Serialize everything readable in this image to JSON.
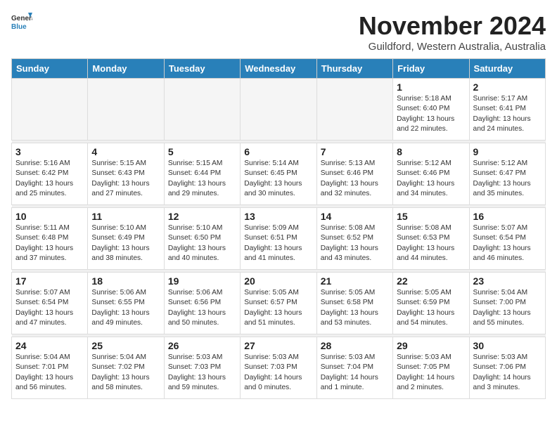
{
  "logo": {
    "general": "General",
    "blue": "Blue"
  },
  "title": "November 2024",
  "location": "Guildford, Western Australia, Australia",
  "weekdays": [
    "Sunday",
    "Monday",
    "Tuesday",
    "Wednesday",
    "Thursday",
    "Friday",
    "Saturday"
  ],
  "weeks": [
    [
      {
        "day": "",
        "detail": ""
      },
      {
        "day": "",
        "detail": ""
      },
      {
        "day": "",
        "detail": ""
      },
      {
        "day": "",
        "detail": ""
      },
      {
        "day": "",
        "detail": ""
      },
      {
        "day": "1",
        "detail": "Sunrise: 5:18 AM\nSunset: 6:40 PM\nDaylight: 13 hours\nand 22 minutes."
      },
      {
        "day": "2",
        "detail": "Sunrise: 5:17 AM\nSunset: 6:41 PM\nDaylight: 13 hours\nand 24 minutes."
      }
    ],
    [
      {
        "day": "3",
        "detail": "Sunrise: 5:16 AM\nSunset: 6:42 PM\nDaylight: 13 hours\nand 25 minutes."
      },
      {
        "day": "4",
        "detail": "Sunrise: 5:15 AM\nSunset: 6:43 PM\nDaylight: 13 hours\nand 27 minutes."
      },
      {
        "day": "5",
        "detail": "Sunrise: 5:15 AM\nSunset: 6:44 PM\nDaylight: 13 hours\nand 29 minutes."
      },
      {
        "day": "6",
        "detail": "Sunrise: 5:14 AM\nSunset: 6:45 PM\nDaylight: 13 hours\nand 30 minutes."
      },
      {
        "day": "7",
        "detail": "Sunrise: 5:13 AM\nSunset: 6:46 PM\nDaylight: 13 hours\nand 32 minutes."
      },
      {
        "day": "8",
        "detail": "Sunrise: 5:12 AM\nSunset: 6:46 PM\nDaylight: 13 hours\nand 34 minutes."
      },
      {
        "day": "9",
        "detail": "Sunrise: 5:12 AM\nSunset: 6:47 PM\nDaylight: 13 hours\nand 35 minutes."
      }
    ],
    [
      {
        "day": "10",
        "detail": "Sunrise: 5:11 AM\nSunset: 6:48 PM\nDaylight: 13 hours\nand 37 minutes."
      },
      {
        "day": "11",
        "detail": "Sunrise: 5:10 AM\nSunset: 6:49 PM\nDaylight: 13 hours\nand 38 minutes."
      },
      {
        "day": "12",
        "detail": "Sunrise: 5:10 AM\nSunset: 6:50 PM\nDaylight: 13 hours\nand 40 minutes."
      },
      {
        "day": "13",
        "detail": "Sunrise: 5:09 AM\nSunset: 6:51 PM\nDaylight: 13 hours\nand 41 minutes."
      },
      {
        "day": "14",
        "detail": "Sunrise: 5:08 AM\nSunset: 6:52 PM\nDaylight: 13 hours\nand 43 minutes."
      },
      {
        "day": "15",
        "detail": "Sunrise: 5:08 AM\nSunset: 6:53 PM\nDaylight: 13 hours\nand 44 minutes."
      },
      {
        "day": "16",
        "detail": "Sunrise: 5:07 AM\nSunset: 6:54 PM\nDaylight: 13 hours\nand 46 minutes."
      }
    ],
    [
      {
        "day": "17",
        "detail": "Sunrise: 5:07 AM\nSunset: 6:54 PM\nDaylight: 13 hours\nand 47 minutes."
      },
      {
        "day": "18",
        "detail": "Sunrise: 5:06 AM\nSunset: 6:55 PM\nDaylight: 13 hours\nand 49 minutes."
      },
      {
        "day": "19",
        "detail": "Sunrise: 5:06 AM\nSunset: 6:56 PM\nDaylight: 13 hours\nand 50 minutes."
      },
      {
        "day": "20",
        "detail": "Sunrise: 5:05 AM\nSunset: 6:57 PM\nDaylight: 13 hours\nand 51 minutes."
      },
      {
        "day": "21",
        "detail": "Sunrise: 5:05 AM\nSunset: 6:58 PM\nDaylight: 13 hours\nand 53 minutes."
      },
      {
        "day": "22",
        "detail": "Sunrise: 5:05 AM\nSunset: 6:59 PM\nDaylight: 13 hours\nand 54 minutes."
      },
      {
        "day": "23",
        "detail": "Sunrise: 5:04 AM\nSunset: 7:00 PM\nDaylight: 13 hours\nand 55 minutes."
      }
    ],
    [
      {
        "day": "24",
        "detail": "Sunrise: 5:04 AM\nSunset: 7:01 PM\nDaylight: 13 hours\nand 56 minutes."
      },
      {
        "day": "25",
        "detail": "Sunrise: 5:04 AM\nSunset: 7:02 PM\nDaylight: 13 hours\nand 58 minutes."
      },
      {
        "day": "26",
        "detail": "Sunrise: 5:03 AM\nSunset: 7:03 PM\nDaylight: 13 hours\nand 59 minutes."
      },
      {
        "day": "27",
        "detail": "Sunrise: 5:03 AM\nSunset: 7:03 PM\nDaylight: 14 hours\nand 0 minutes."
      },
      {
        "day": "28",
        "detail": "Sunrise: 5:03 AM\nSunset: 7:04 PM\nDaylight: 14 hours\nand 1 minute."
      },
      {
        "day": "29",
        "detail": "Sunrise: 5:03 AM\nSunset: 7:05 PM\nDaylight: 14 hours\nand 2 minutes."
      },
      {
        "day": "30",
        "detail": "Sunrise: 5:03 AM\nSunset: 7:06 PM\nDaylight: 14 hours\nand 3 minutes."
      }
    ]
  ]
}
